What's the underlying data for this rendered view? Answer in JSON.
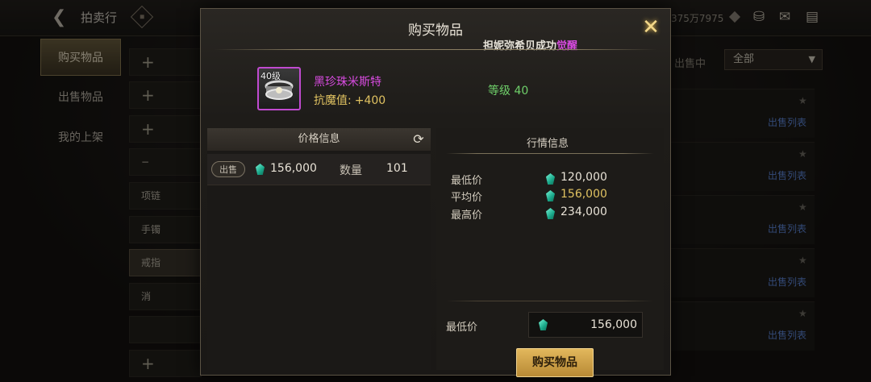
{
  "topbar": {
    "title": "拍卖行",
    "currency": "375万7975"
  },
  "sidebar": {
    "tabs": [
      {
        "label": "购买物品",
        "active": true
      },
      {
        "label": "出售物品",
        "active": false
      },
      {
        "label": "我的上架",
        "active": false
      }
    ]
  },
  "categories": {
    "items": [
      "项链",
      "手镯",
      "戒指",
      "消"
    ]
  },
  "right_filter": {
    "label": "出售中",
    "selected": "全部"
  },
  "right_list": {
    "link_label": "出售列表"
  },
  "modal": {
    "title": "购买物品",
    "notice_prefix": "担妮弥希贝成功",
    "notice_highlight": "觉醒",
    "item": {
      "level_tag": "40级",
      "name": "黑珍珠米斯特",
      "stat_label": "抗魔值:",
      "stat_value": "+400",
      "grade": "等级 40"
    },
    "price_info": {
      "header": "价格信息",
      "sale_badge": "出售",
      "price": "156,000",
      "qty_label": "数量",
      "qty": "101"
    },
    "market_info": {
      "header": "行情信息",
      "min_label": "最低价",
      "min": "120,000",
      "avg_label": "平均价",
      "avg": "156,000",
      "max_label": "最高价",
      "max": "234,000"
    },
    "buy": {
      "min_price_label": "最低价",
      "min_price_value": "156,000",
      "button_label": "购买物品"
    }
  },
  "colors": {
    "item_purple": "#d84be0",
    "gold": "#e0c261",
    "green": "#6fd06a",
    "button_gold": "#d4a549"
  }
}
